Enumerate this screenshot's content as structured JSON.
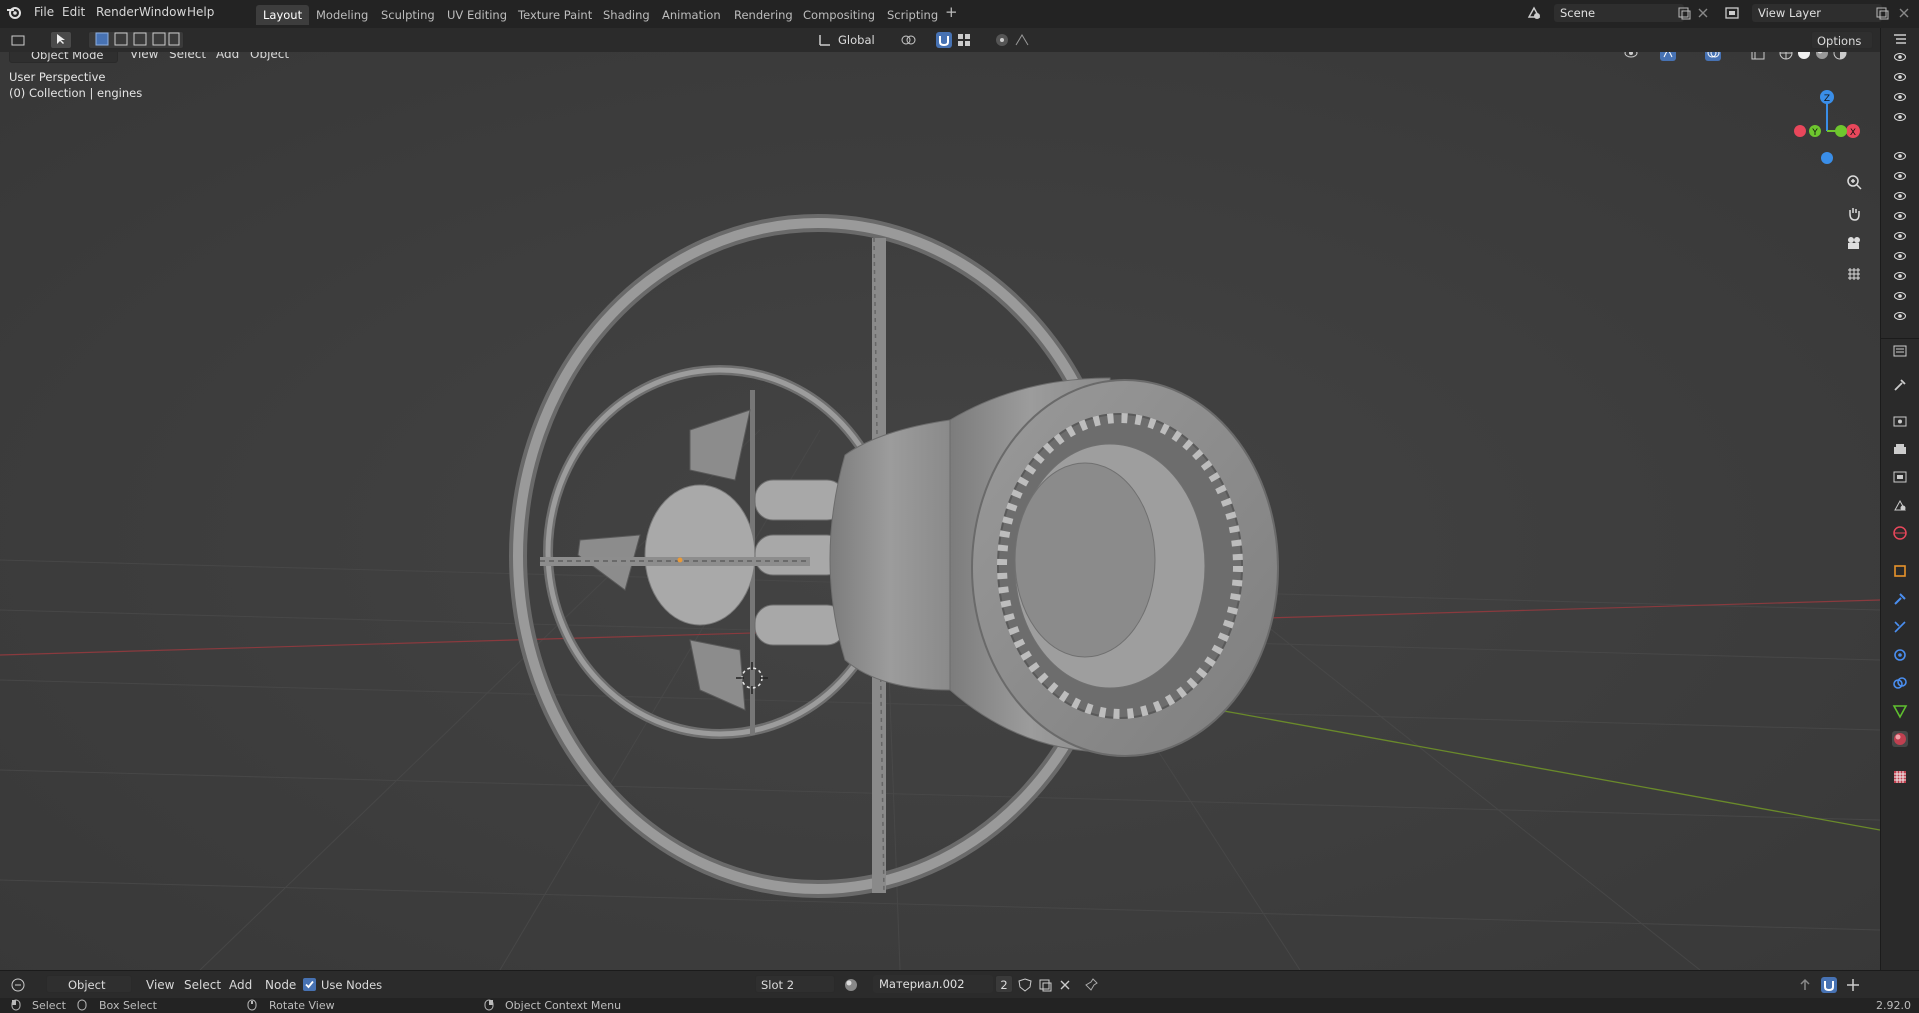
{
  "menubar": {
    "items": [
      "File",
      "Edit",
      "Render",
      "Window",
      "Help"
    ]
  },
  "workspaces": {
    "tabs": [
      "Layout",
      "Modeling",
      "Sculpting",
      "UV Editing",
      "Texture Paint",
      "Shading",
      "Animation",
      "Rendering",
      "Compositing",
      "Scripting"
    ],
    "active": "Layout",
    "add": "+"
  },
  "scene": {
    "name": "Scene"
  },
  "view_layer": {
    "name": "View Layer"
  },
  "toolbar": {
    "transform_orientation": "Global",
    "options_label": "Options"
  },
  "viewport_header": {
    "mode": "Object Mode",
    "menus": [
      "View",
      "Select",
      "Add",
      "Object"
    ]
  },
  "viewport": {
    "perspective_label": "User Perspective",
    "collection_label": "(0) Collection | engines",
    "gizmo": {
      "z": "Z",
      "y": "Y",
      "x": "X"
    }
  },
  "shader_header": {
    "editor": "Object",
    "menus": [
      "View",
      "Select",
      "Add",
      "Node"
    ],
    "use_nodes_label": "Use Nodes",
    "use_nodes_checked": true,
    "slot": "Slot 2",
    "material": "Материал.002",
    "users": "2"
  },
  "statusbar": {
    "select": "Select",
    "box_select": "Box Select",
    "rotate_view": "Rotate View",
    "context_menu": "Object Context Menu",
    "version": "2.92.0"
  },
  "colors": {
    "accent": "#4772b3",
    "axis_x": "#e8475b",
    "axis_y": "#6ec62e",
    "axis_z": "#3a8ee8"
  }
}
